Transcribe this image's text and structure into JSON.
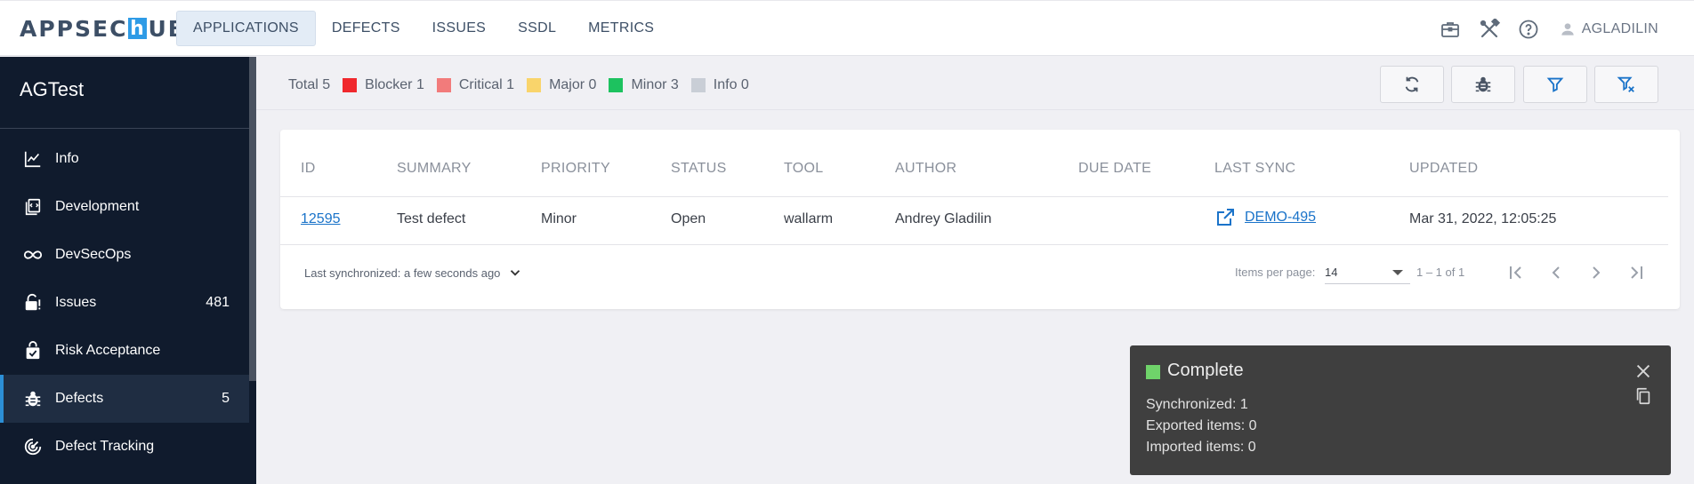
{
  "logo": {
    "part1": "APPSEC",
    "h": "h",
    "part2": "UB"
  },
  "nav": {
    "items": [
      "APPLICATIONS",
      "DEFECTS",
      "ISSUES",
      "SSDL",
      "METRICS"
    ],
    "active": "APPLICATIONS"
  },
  "topbar": {
    "icons": [
      "briefcase-icon",
      "tools-icon",
      "help-icon"
    ],
    "user": "AGLADILIN"
  },
  "sidebar": {
    "project": "AGTest",
    "items": [
      {
        "label": "Info",
        "icon": "chart-line-icon",
        "count": ""
      },
      {
        "label": "Development",
        "icon": "code-file-icon",
        "count": ""
      },
      {
        "label": "DevSecOps",
        "icon": "infinity-icon",
        "count": ""
      },
      {
        "label": "Issues",
        "icon": "lock-alert-icon",
        "count": "481"
      },
      {
        "label": "Risk Acceptance",
        "icon": "shield-check-icon",
        "count": ""
      },
      {
        "label": "Defects",
        "icon": "bug-icon",
        "count": "5"
      },
      {
        "label": "Defect Tracking",
        "icon": "target-icon",
        "count": ""
      }
    ],
    "active": "Defects"
  },
  "summary": {
    "total": "Total 5",
    "segments": [
      {
        "label": "Blocker 1",
        "color": "#f0282d"
      },
      {
        "label": "Critical 1",
        "color": "#f27b7b"
      },
      {
        "label": "Major 0",
        "color": "#f9d46b"
      },
      {
        "label": "Minor 3",
        "color": "#1dc25f"
      },
      {
        "label": "Info 0",
        "color": "#c9ced6"
      }
    ],
    "buttons": [
      "sync-icon",
      "bug-icon",
      "filter-icon",
      "filter-clear-icon"
    ],
    "accent": "#1a73c9"
  },
  "table": {
    "headers": [
      "ID",
      "SUMMARY",
      "PRIORITY",
      "STATUS",
      "TOOL",
      "AUTHOR",
      "DUE DATE",
      "LAST SYNC",
      "UPDATED"
    ],
    "rows": [
      {
        "id": "12595",
        "summary": "Test defect",
        "priority": "Minor",
        "status": "Open",
        "tool": "wallarm",
        "author": "Andrey Gladilin",
        "due_date": "",
        "last_sync": "DEMO-495",
        "updated": "Mar 31, 2022, 12:05:25"
      }
    ],
    "footer": {
      "last_synced": "Last synchronized: a few seconds ago",
      "items_per_page_label": "Items per page:",
      "items_per_page": "14",
      "range": "1 – 1 of 1"
    }
  },
  "toast": {
    "title": "Complete",
    "lines": [
      "Synchronized: 1",
      "Exported items: 0",
      "Imported items: 0"
    ],
    "status_color": "#6fd36a"
  }
}
